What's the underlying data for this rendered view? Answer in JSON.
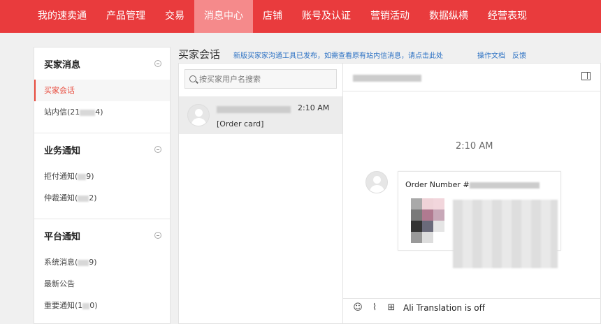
{
  "topnav": {
    "items": [
      "我的速卖通",
      "产品管理",
      "交易",
      "消息中心",
      "店铺",
      "账号及认证",
      "营销活动",
      "数据纵横",
      "经营表现"
    ],
    "active": "消息中心"
  },
  "sidebar": {
    "groups": [
      {
        "title": "买家消息",
        "items": [
          {
            "label": "买家会话"
          },
          {
            "label": "站内信(21",
            "suffix": "4)"
          }
        ]
      },
      {
        "title": "业务通知",
        "items": [
          {
            "label": "拒付通知(",
            "suffix": "9)"
          },
          {
            "label": "仲裁通知(",
            "suffix": "2)"
          }
        ]
      },
      {
        "title": "平台通知",
        "items": [
          {
            "label": "系统消息(",
            "suffix": "9)"
          },
          {
            "label": "最新公告"
          },
          {
            "label": "重要通知(1",
            "suffix": "0)"
          }
        ]
      }
    ]
  },
  "header": {
    "title": "买家会话",
    "notice": "新版买家家沟通工具已发布，如需查看原有站内信消息，请点击此处",
    "link_docs": "操作文档",
    "link_feedback": "反馈"
  },
  "conversations": {
    "search_placeholder": "按买家用户名搜索",
    "items": [
      {
        "time": "2:10 AM",
        "preview": "[Order card]"
      }
    ]
  },
  "chat": {
    "timestamp": "2:10 AM",
    "card_order_label": "Order Number #",
    "translation_status": "Ali Translation is off",
    "icons": [
      "emoji-icon",
      "attachment-icon",
      "order-icon"
    ]
  },
  "colors": {
    "brand": "#e93b3d",
    "active_tab": "#f58a8b",
    "link": "#2d72c4"
  }
}
